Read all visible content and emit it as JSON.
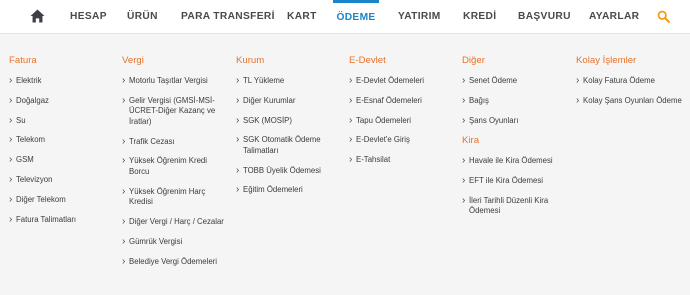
{
  "nav": {
    "items": [
      "HESAP",
      "ÜRÜN",
      "PARA TRANSFERİ",
      "KART",
      "ÖDEME",
      "YATIRIM",
      "KREDİ",
      "BAŞVURU",
      "AYARLAR"
    ],
    "active_index": 4,
    "home_icon": "home-icon",
    "search_icon": "search-icon",
    "active_color": "#1a84c8",
    "search_color": "#f39c12"
  },
  "menu": {
    "heading_color": "#e8722c",
    "columns": [
      {
        "title": "Fatura",
        "links": [
          "Elektrik",
          "Doğalgaz",
          "Su",
          "Telekom",
          "GSM",
          "Televizyon",
          "Diğer Telekom",
          "Fatura Talimatları"
        ]
      },
      {
        "title": "Vergi",
        "links": [
          "Motorlu Taşıtlar Vergisi",
          "Gelir Vergisi (GMSİ-MSİ-ÜCRET-Diğer Kazanç ve İratlar)",
          "Trafik Cezası",
          "Yüksek Öğrenim Kredi Borcu",
          "Yüksek Öğrenim Harç Kredisi",
          "Diğer Vergi / Harç / Cezalar",
          "Gümrük Vergisi",
          "Belediye Vergi Ödemeleri"
        ]
      },
      {
        "title": "Kurum",
        "links": [
          "TL Yükleme",
          "Diğer Kurumlar",
          "SGK (MOSİP)",
          "SGK Otomatik Ödeme Talimatları",
          "TOBB Üyelik Ödemesi",
          "Eğitim Ödemeleri"
        ]
      },
      {
        "title": "E-Devlet",
        "links": [
          "E-Devlet Ödemeleri",
          "E-Esnaf Ödemeleri",
          "Tapu Ödemeleri",
          "E-Devlet'e Giriş",
          "E-Tahsilat"
        ]
      },
      {
        "title": "Diğer",
        "links": [
          "Senet Ödeme",
          "Bağış",
          "Şans Oyunları"
        ],
        "sub_title": "Kira",
        "sub_links": [
          "Havale ile Kira Ödemesi",
          "EFT ile Kira Ödemesi",
          "İleri Tarihli Düzenli Kira Ödemesi"
        ]
      },
      {
        "title": "Kolay İşlemler",
        "links": [
          "Kolay Fatura Ödeme",
          "Kolay Şans Oyunları Ödeme"
        ]
      }
    ]
  }
}
